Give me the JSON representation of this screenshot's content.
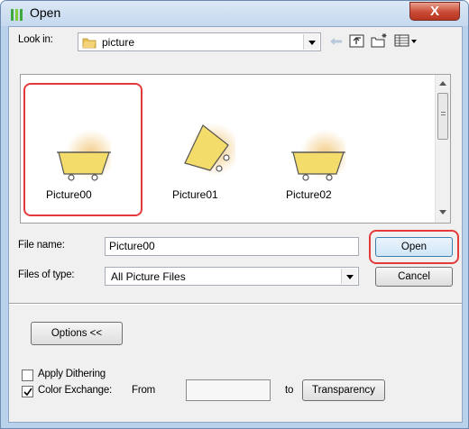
{
  "window": {
    "title": "Open",
    "close_label": "X"
  },
  "look_in": {
    "label": "Look in:",
    "folder": "picture"
  },
  "toolbar": {
    "icons": [
      "back-arrow-icon",
      "up-folder-icon",
      "new-folder-icon",
      "view-menu-icon"
    ]
  },
  "thumbnails": [
    {
      "name": "Picture00",
      "selected": true
    },
    {
      "name": "Picture01",
      "selected": false
    },
    {
      "name": "Picture02",
      "selected": false
    }
  ],
  "file_name": {
    "label": "File name:",
    "value": "Picture00"
  },
  "files_of_type": {
    "label": "Files of type:",
    "value": "All Picture Files"
  },
  "buttons": {
    "open": "Open",
    "cancel": "Cancel",
    "options": "Options <<",
    "transparency": "Transparency"
  },
  "options": {
    "apply_dithering": {
      "label": "Apply Dithering",
      "checked": false
    },
    "color_exchange": {
      "label": "Color Exchange:",
      "checked": true
    },
    "from_label": "From",
    "from_value": "",
    "to_label": "to"
  },
  "colors": {
    "highlight": "#e53a3a",
    "cart_fill": "#f3dc6a",
    "cart_glow": "#f2c87c"
  }
}
